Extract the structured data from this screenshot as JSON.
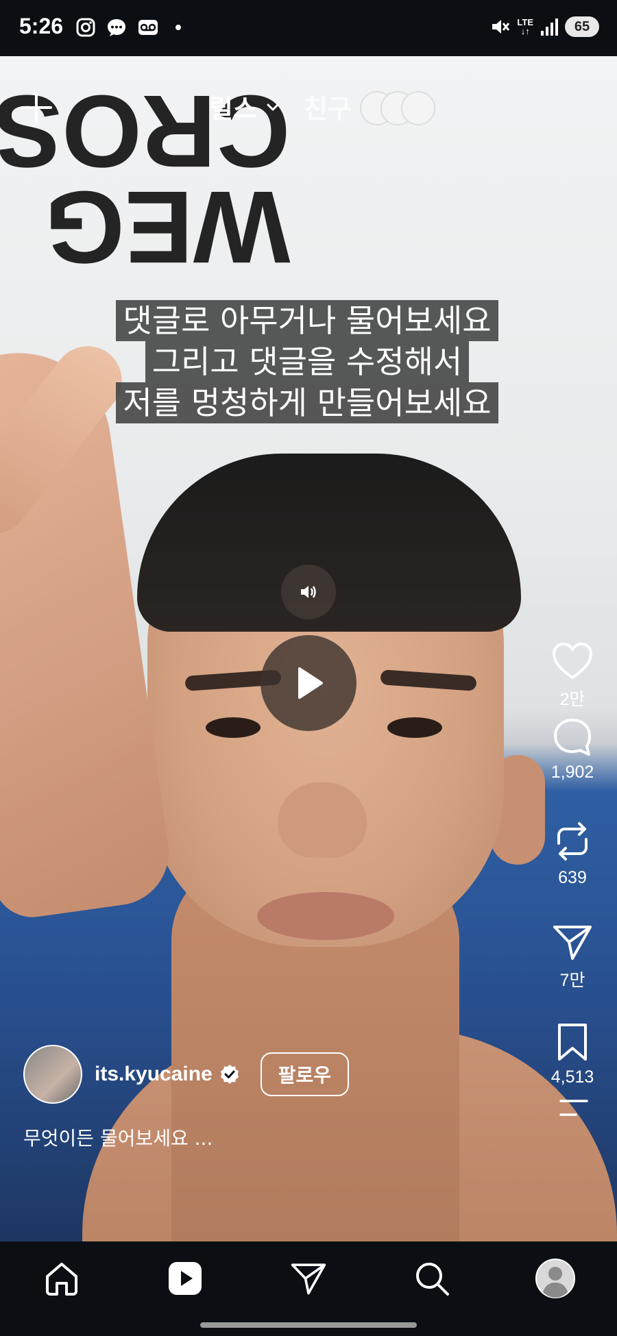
{
  "status_bar": {
    "time": "5:26",
    "network": "LTE",
    "battery": "65"
  },
  "top_bar": {
    "tab_reels": "릴스",
    "tab_friends": "친구"
  },
  "video": {
    "wall_text": [
      "WEG",
      "CROS"
    ],
    "caption_lines": [
      "댓글로 아무거나 물어보세요",
      "그리고 댓글을 수정해서",
      "저를 멍청하게 만들어보세요"
    ]
  },
  "actions": {
    "likes": "2만",
    "comments": "1,902",
    "reposts": "639",
    "shares": "7만",
    "saves": "4,513"
  },
  "author": {
    "username": "its.kyucaine",
    "follow_label": "팔로우",
    "description": "무엇이든 물어보세요 ..."
  },
  "icons": {
    "status_left": [
      "instagram-icon",
      "chat-bubble-icon",
      "voicemail-icon"
    ],
    "status_right": [
      "mute-icon",
      "signal-icon"
    ],
    "nav": [
      "home-icon",
      "reels-icon",
      "direct-icon",
      "search-icon",
      "profile-icon"
    ]
  }
}
